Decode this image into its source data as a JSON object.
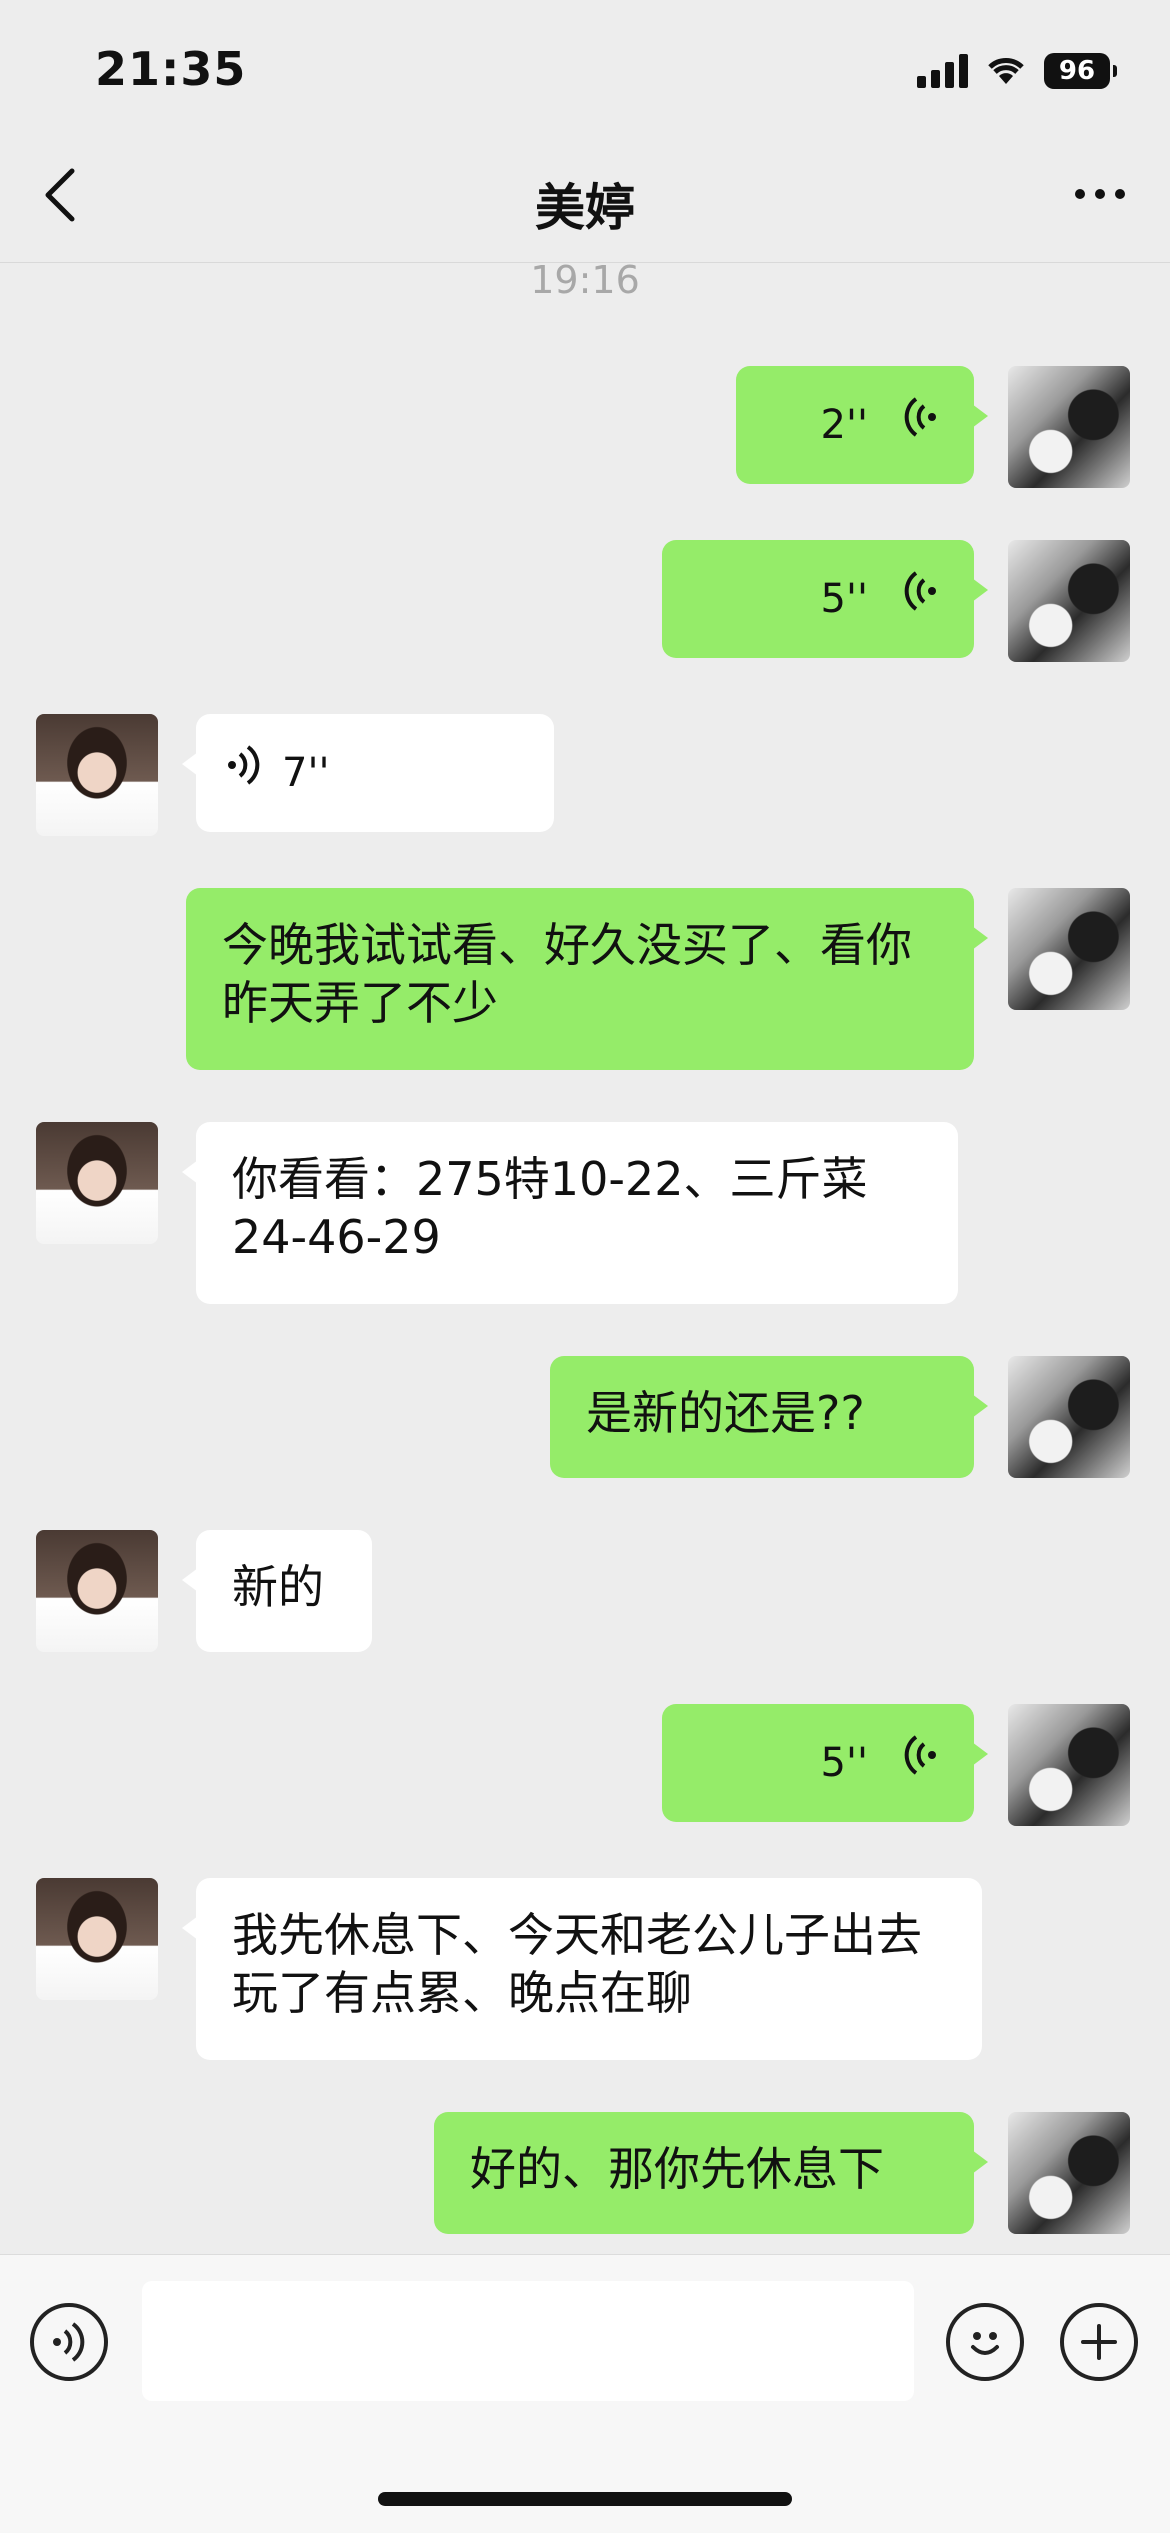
{
  "status_bar": {
    "time": "21:35",
    "battery": "96"
  },
  "nav": {
    "title": "美婷",
    "back_icon": "‹",
    "more_icon": "···"
  },
  "timestamp": "19:16",
  "messages": [
    {
      "from": "me",
      "type": "voice",
      "duration": "2''"
    },
    {
      "from": "me",
      "type": "voice",
      "duration": "5''"
    },
    {
      "from": "her",
      "type": "voice",
      "duration": "7''"
    },
    {
      "from": "me",
      "type": "text",
      "text": "今晚我试试看、好久没买了、看你昨天弄了不少"
    },
    {
      "from": "her",
      "type": "text",
      "text": "你看看：275特10-22、三斤菜24-46-29"
    },
    {
      "from": "me",
      "type": "text",
      "text": "是新的还是??"
    },
    {
      "from": "her",
      "type": "text",
      "text": "新的"
    },
    {
      "from": "me",
      "type": "voice",
      "duration": "5''"
    },
    {
      "from": "her",
      "type": "text",
      "text": "我先休息下、今天和老公儿子出去玩了有点累、晚点在聊"
    },
    {
      "from": "me",
      "type": "text",
      "text": "好的、那你先休息下"
    }
  ],
  "input": {
    "voice_icon": "voice-mode-icon",
    "emoji_icon": "emoji-icon",
    "plus_icon": "plus-icon",
    "value": ""
  }
}
